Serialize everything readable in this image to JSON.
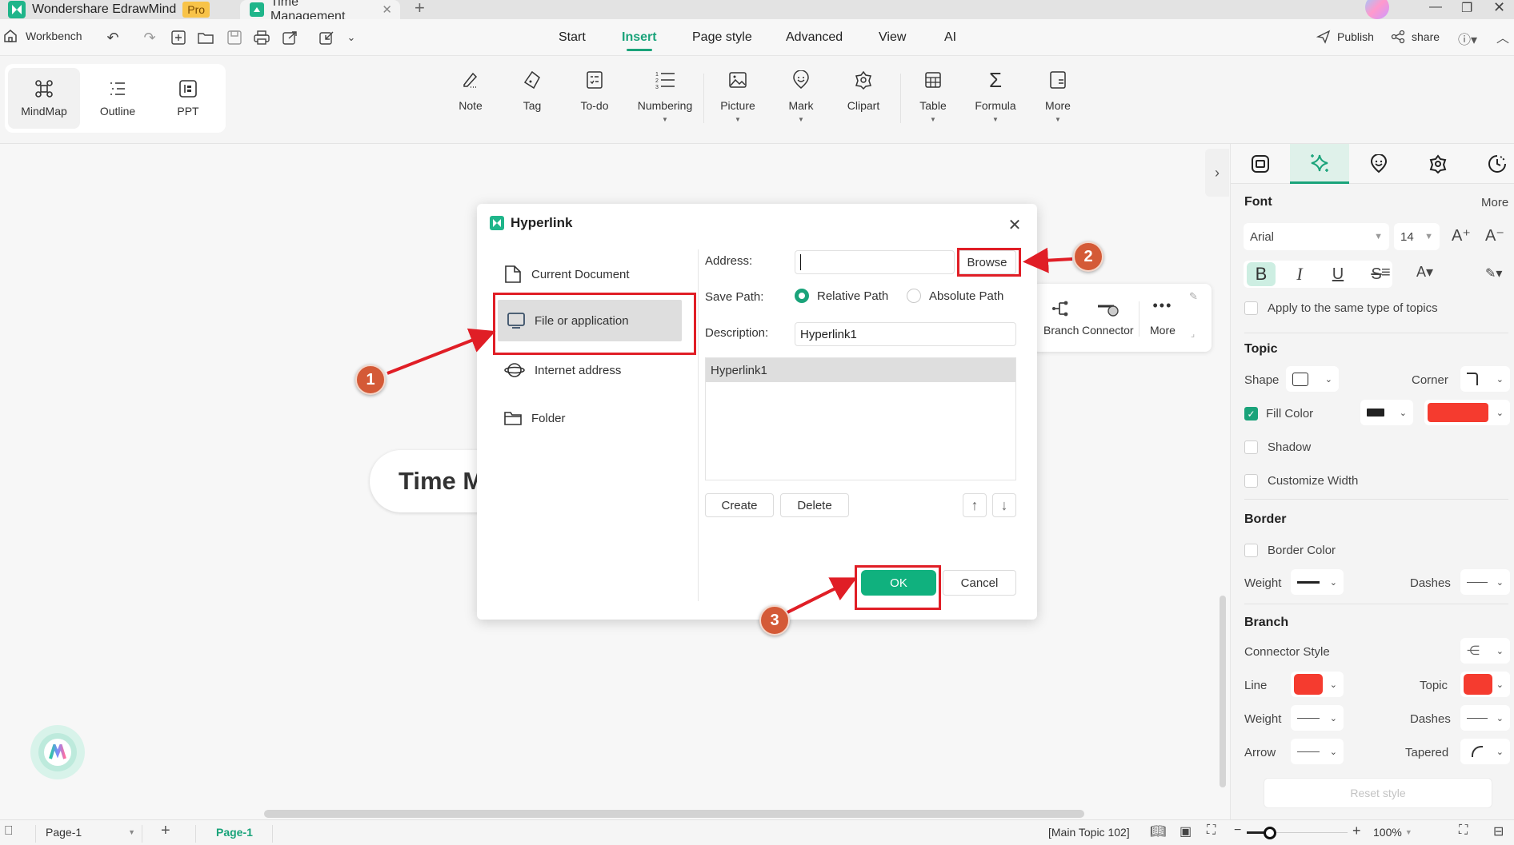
{
  "app": {
    "name": "Wondershare EdrawMind",
    "badge": "Pro",
    "doc_tab": "Time Management",
    "new_tab": "+"
  },
  "toolbar": {
    "workbench": "Workbench",
    "menu_tabs": [
      "Start",
      "Insert",
      "Page style",
      "Advanced",
      "View",
      "AI"
    ],
    "active_menu": "Insert",
    "publish": "Publish",
    "share": "share"
  },
  "views": [
    {
      "label": "MindMap",
      "icon": "mindmap-icon",
      "selected": true
    },
    {
      "label": "Outline",
      "icon": "outline-icon",
      "selected": false
    },
    {
      "label": "PPT",
      "icon": "ppt-icon",
      "selected": false
    }
  ],
  "ribbon": [
    {
      "label": "Note",
      "icon": "note-icon",
      "dropdown": false
    },
    {
      "label": "Tag",
      "icon": "tag-icon",
      "dropdown": false
    },
    {
      "label": "To-do",
      "icon": "todo-icon",
      "dropdown": false
    },
    {
      "label": "Numbering",
      "icon": "numbering-icon",
      "dropdown": true
    },
    {
      "label": "Picture",
      "icon": "picture-icon",
      "dropdown": true
    },
    {
      "label": "Mark",
      "icon": "mark-icon",
      "dropdown": true
    },
    {
      "label": "Clipart",
      "icon": "clipart-icon",
      "dropdown": false
    },
    {
      "label": "Table",
      "icon": "table-icon",
      "dropdown": true
    },
    {
      "label": "Formula",
      "icon": "formula-icon",
      "dropdown": true
    },
    {
      "label": "More",
      "icon": "more-icon",
      "dropdown": true
    }
  ],
  "canvas": {
    "topic_text": "Time M",
    "floating_toolbar": {
      "branch": "Branch",
      "connector": "Connector",
      "more": "More"
    }
  },
  "dialog": {
    "title": "Hyperlink",
    "link_types": [
      {
        "label": "Current Document",
        "icon": "document-icon",
        "selected": false
      },
      {
        "label": "File or application",
        "icon": "monitor-icon",
        "selected": true
      },
      {
        "label": "Internet address",
        "icon": "globe-icon",
        "selected": false
      },
      {
        "label": "Folder",
        "icon": "folder-icon",
        "selected": false
      }
    ],
    "address_label": "Address:",
    "address_value": "",
    "browse": "Browse",
    "save_path_label": "Save Path:",
    "save_path_options": [
      "Relative Path",
      "Absolute Path"
    ],
    "save_path_selected": "Relative Path",
    "description_label": "Description:",
    "description_value": "Hyperlink1",
    "links_list": [
      "Hyperlink1"
    ],
    "create": "Create",
    "delete": "Delete",
    "ok": "OK",
    "cancel": "Cancel"
  },
  "annotations": [
    "1",
    "2",
    "3"
  ],
  "panel": {
    "font": {
      "title": "Font",
      "more": "More",
      "family": "Arial",
      "size": "14",
      "apply_same": "Apply to the same type of topics"
    },
    "topic": {
      "title": "Topic",
      "shape": "Shape",
      "corner": "Corner",
      "fill_color": "Fill Color",
      "fill_checked": true,
      "fill_swatch": "#f53b2f",
      "shadow": "Shadow",
      "customize_width": "Customize Width"
    },
    "border": {
      "title": "Border",
      "border_color": "Border Color",
      "weight": "Weight",
      "dashes": "Dashes"
    },
    "branch": {
      "title": "Branch",
      "connector_style": "Connector Style",
      "line": "Line",
      "line_color": "#f53b2f",
      "topic": "Topic",
      "topic_color": "#f53b2f",
      "weight": "Weight",
      "dashes": "Dashes",
      "arrow": "Arrow",
      "tapered": "Tapered",
      "reset": "Reset style"
    }
  },
  "status": {
    "page_select": "Page-1",
    "page_tab": "Page-1",
    "selection": "[Main Topic 102]",
    "zoom": "100%",
    "zoom_level": 1.0
  },
  "colors": {
    "accent": "#1aa37a",
    "annotation_red": "#e01e26",
    "badge": "#d45a37"
  }
}
